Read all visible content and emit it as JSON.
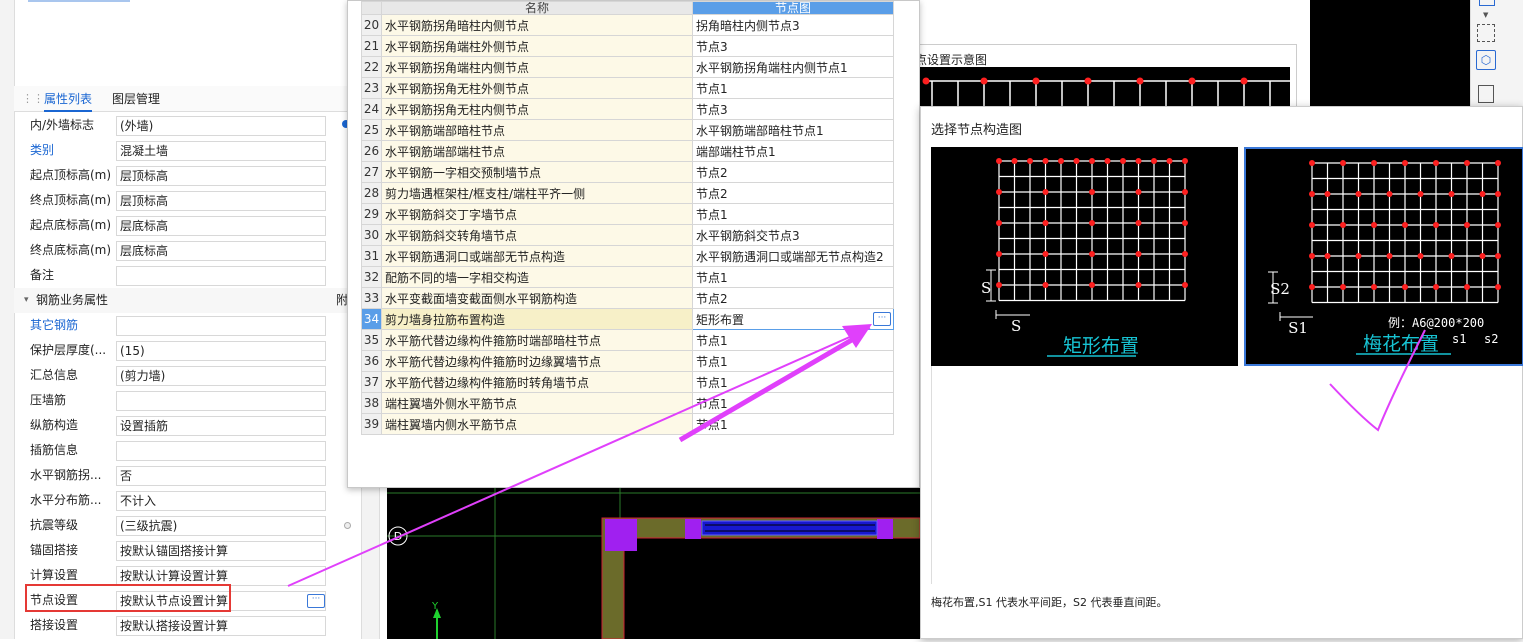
{
  "left_panel": {
    "tabs": [
      "属性列表",
      "图层管理"
    ],
    "rows": [
      {
        "label": "内/外墙标志",
        "value": "(外墙)",
        "blue": false
      },
      {
        "label": "类别",
        "value": "混凝土墙",
        "blue": true
      },
      {
        "label": "起点顶标高(m)",
        "value": "层顶标高",
        "blue": false
      },
      {
        "label": "终点顶标高(m)",
        "value": "层顶标高",
        "blue": false
      },
      {
        "label": "起点底标高(m)",
        "value": "层底标高",
        "blue": false
      },
      {
        "label": "终点底标高(m)",
        "value": "层底标高",
        "blue": false
      },
      {
        "label": "备注",
        "value": "",
        "blue": false
      }
    ],
    "group_label": "钢筋业务属性",
    "group_extra": "附",
    "rebar_rows": [
      {
        "label": "其它钢筋",
        "value": "",
        "blue": true
      },
      {
        "label": "保护层厚度(...",
        "value": "(15)",
        "blue": false
      },
      {
        "label": "汇总信息",
        "value": "(剪力墙)",
        "blue": false
      },
      {
        "label": "压墙筋",
        "value": "",
        "blue": false
      },
      {
        "label": "纵筋构造",
        "value": "设置插筋",
        "blue": false
      },
      {
        "label": "插筋信息",
        "value": "",
        "blue": false
      },
      {
        "label": "水平钢筋拐...",
        "value": "否",
        "blue": false
      },
      {
        "label": "水平分布筋...",
        "value": "不计入",
        "blue": false
      },
      {
        "label": "抗震等级",
        "value": "(三级抗震)",
        "blue": false
      },
      {
        "label": "锚固搭接",
        "value": "按默认锚固搭接计算",
        "blue": false
      },
      {
        "label": "计算设置",
        "value": "按默认计算设置计算",
        "blue": false
      },
      {
        "label": "节点设置",
        "value": "按默认节点设置计算",
        "blue": false
      },
      {
        "label": "搭接设置",
        "value": "按默认搭接设置计算",
        "blue": false
      }
    ]
  },
  "node_table": {
    "headers": [
      "名称",
      "节点图"
    ],
    "rows": [
      {
        "n": "20",
        "name": "水平钢筋拐角暗柱内侧节点",
        "node": "拐角暗柱内侧节点3"
      },
      {
        "n": "21",
        "name": "水平钢筋拐角端柱外侧节点",
        "node": "节点3"
      },
      {
        "n": "22",
        "name": "水平钢筋拐角端柱内侧节点",
        "node": "水平钢筋拐角端柱内侧节点1"
      },
      {
        "n": "23",
        "name": "水平钢筋拐角无柱外侧节点",
        "node": "节点1"
      },
      {
        "n": "24",
        "name": "水平钢筋拐角无柱内侧节点",
        "node": "节点3"
      },
      {
        "n": "25",
        "name": "水平钢筋端部暗柱节点",
        "node": "水平钢筋端部暗柱节点1"
      },
      {
        "n": "26",
        "name": "水平钢筋端部端柱节点",
        "node": "端部端柱节点1"
      },
      {
        "n": "27",
        "name": "水平钢筋一字相交预制墙节点",
        "node": "节点2"
      },
      {
        "n": "28",
        "name": "剪力墙遇框架柱/框支柱/端柱平齐一侧",
        "node": "节点2"
      },
      {
        "n": "29",
        "name": "水平钢筋斜交丁字墙节点",
        "node": "节点1"
      },
      {
        "n": "30",
        "name": "水平钢筋斜交转角墙节点",
        "node": "水平钢筋斜交节点3"
      },
      {
        "n": "31",
        "name": "水平钢筋遇洞口或端部无节点构造",
        "node": "水平钢筋遇洞口或端部无节点构造2"
      },
      {
        "n": "32",
        "name": "配筋不同的墙一字相交构造",
        "node": "节点1"
      },
      {
        "n": "33",
        "name": "水平变截面墙变截面侧水平钢筋构造",
        "node": "节点2"
      },
      {
        "n": "34",
        "name": "剪力墙身拉筋布置构造",
        "node": "矩形布置"
      },
      {
        "n": "35",
        "name": "水平筋代替边缘构件箍筋时端部暗柱节点",
        "node": "节点1"
      },
      {
        "n": "36",
        "name": "水平筋代替边缘构件箍筋时边缘翼墙节点",
        "node": "节点1"
      },
      {
        "n": "37",
        "name": "水平筋代替边缘构件箍筋时转角墙节点",
        "node": "节点1"
      },
      {
        "n": "38",
        "name": "端柱翼墙外侧水平筋节点",
        "node": "节点1"
      },
      {
        "n": "39",
        "name": "端柱翼墙内侧水平筋节点",
        "node": "节点1"
      }
    ],
    "selected": "34"
  },
  "preview": {
    "title": "节点设置示意图",
    "partial_label": "矩"
  },
  "select_dialog": {
    "title": "选择节点构造图",
    "option1": {
      "caption": "矩形布置",
      "s_label": "S"
    },
    "option2": {
      "caption": "梅花布置",
      "s1_label": "S1",
      "s2_label": "S2",
      "example": "例：A6@200*200",
      "ex_s1": "s1",
      "ex_s2": "s2"
    },
    "description": "梅花布置,S1 代表水平间距，S2 代表垂直间距。"
  },
  "cad": {
    "axis_label": "D",
    "y_label": "Y"
  },
  "colors": {
    "accent": "#1a66d2",
    "annotation": "#e040fb",
    "highlight_red": "#e53935"
  }
}
